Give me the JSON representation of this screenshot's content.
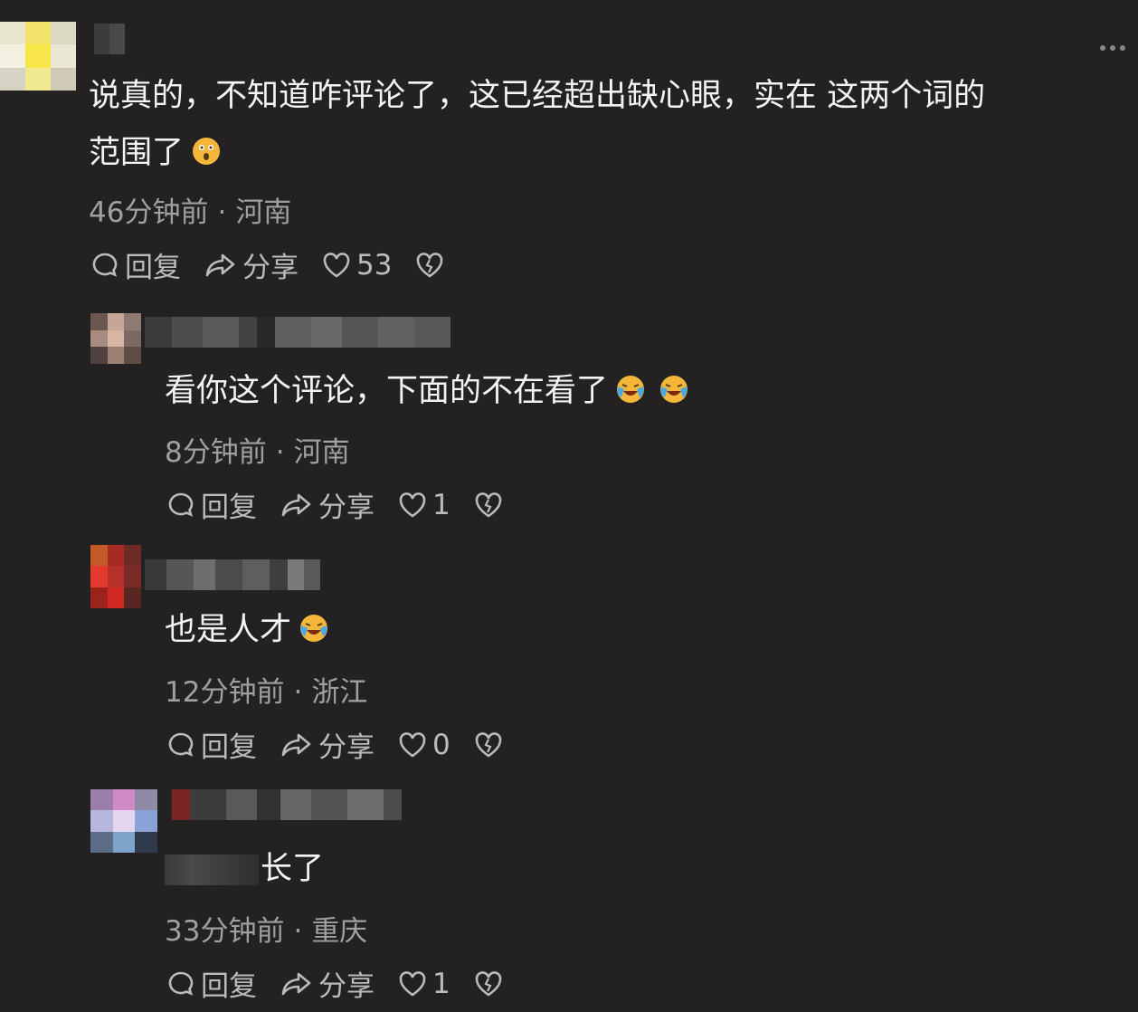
{
  "comments": [
    {
      "text": "说真的，不知道咋评论了，这已经超出缺心眼，实在 这两个词的",
      "text2": "范围了",
      "time": "46分钟前",
      "location": "河南",
      "reply_label": "回复",
      "share_label": "分享",
      "likes": "53"
    },
    {
      "text": "看你这个评论，下面的不在看了",
      "time": "8分钟前",
      "location": "河南",
      "reply_label": "回复",
      "share_label": "分享",
      "likes": "1"
    },
    {
      "text": "也是人才",
      "time": "12分钟前",
      "location": "浙江",
      "reply_label": "回复",
      "share_label": "分享",
      "likes": "0"
    },
    {
      "text": "长了",
      "time": "33分钟前",
      "location": "重庆",
      "reply_label": "回复",
      "share_label": "分享",
      "likes": "1"
    }
  ],
  "separator": "·",
  "icons": {
    "reply": "speech-bubble-icon",
    "share": "share-arrow-icon",
    "like": "heart-icon",
    "dislike": "broken-heart-icon",
    "more": "more-dots-icon"
  },
  "colors": {
    "background": "#232121",
    "text": "#f4f4f4",
    "meta": "#a29f9f"
  }
}
